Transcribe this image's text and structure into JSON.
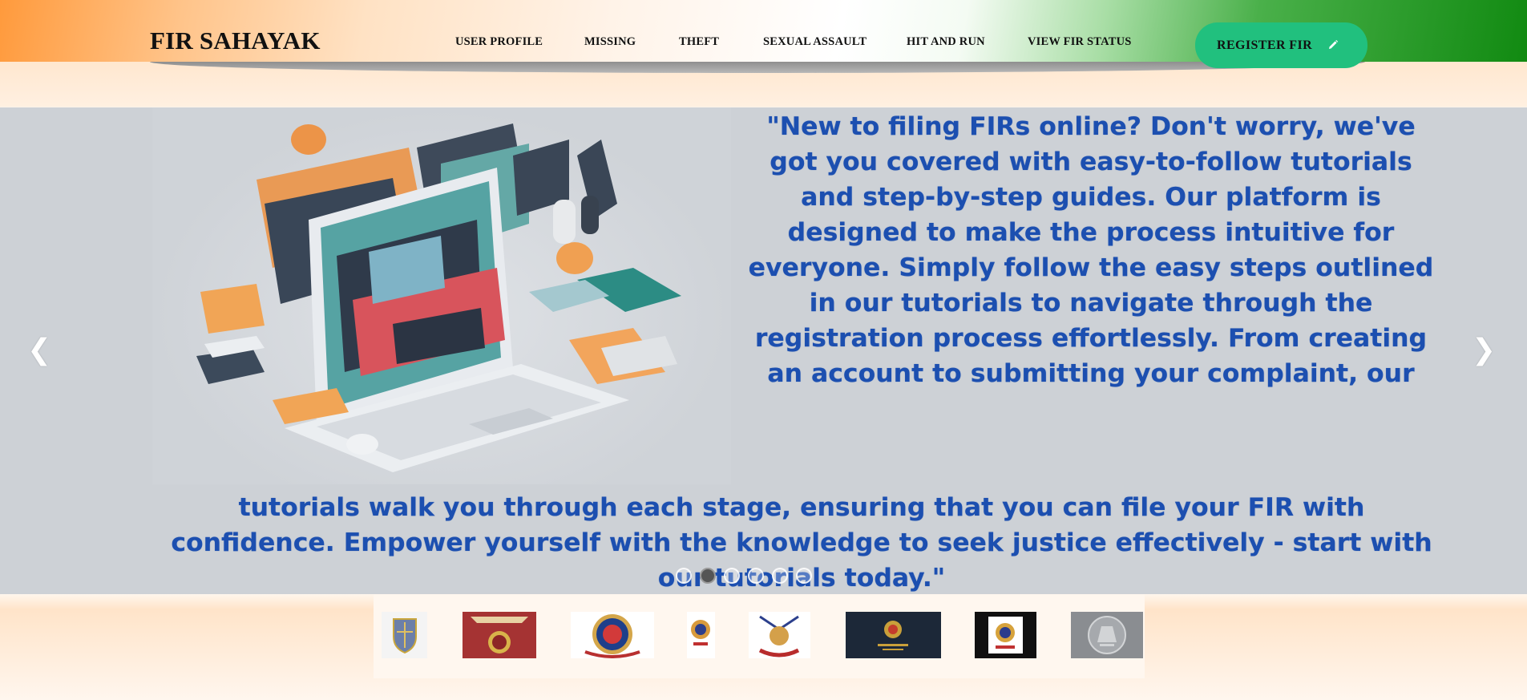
{
  "header": {
    "brand": "FIR SAHAYAK",
    "nav": [
      {
        "label": "USER PROFILE"
      },
      {
        "label": "MISSING"
      },
      {
        "label": "THEFT"
      },
      {
        "label": "SEXUAL ASSAULT"
      },
      {
        "label": "HIT AND RUN"
      },
      {
        "label": "VIEW FIR STATUS"
      }
    ],
    "register_button": {
      "label": "REGISTER FIR",
      "icon": "pencil-icon"
    }
  },
  "carousel": {
    "slide_text_upper": "\"New to filing FIRs online? Don't worry, we've got you covered with easy-to-follow tutorials and step-by-step guides. Our platform is designed to make the process intuitive for everyone. Simply follow the easy steps outlined in our tutorials to navigate through the registration process effortlessly. From creating an account to submitting your complaint, our",
    "slide_text_lower": "tutorials walk you through each stage, ensuring that you can file your FIR with confidence. Empower yourself with the knowledge to seek justice effectively - start with our tutorials today.\"",
    "prev_icon": "chevron-left-icon",
    "next_icon": "chevron-right-icon",
    "prev_glyph": "❮",
    "next_glyph": "❯",
    "slide_count": 6,
    "active_slide": 2,
    "text_color": "#1c4fb0"
  },
  "logos": [
    {
      "name": "police-emblem-shield"
    },
    {
      "name": "jammu-kashmir-police"
    },
    {
      "name": "delhi-police"
    },
    {
      "name": "up-police"
    },
    {
      "name": "uttarakhand-police"
    },
    {
      "name": "karnataka-state-police"
    },
    {
      "name": "police-emblem-dark"
    },
    {
      "name": "tamil-nadu-police"
    }
  ],
  "colors": {
    "saffron": "#ff9a3c",
    "green": "#118a11",
    "button": "#21c07e"
  }
}
